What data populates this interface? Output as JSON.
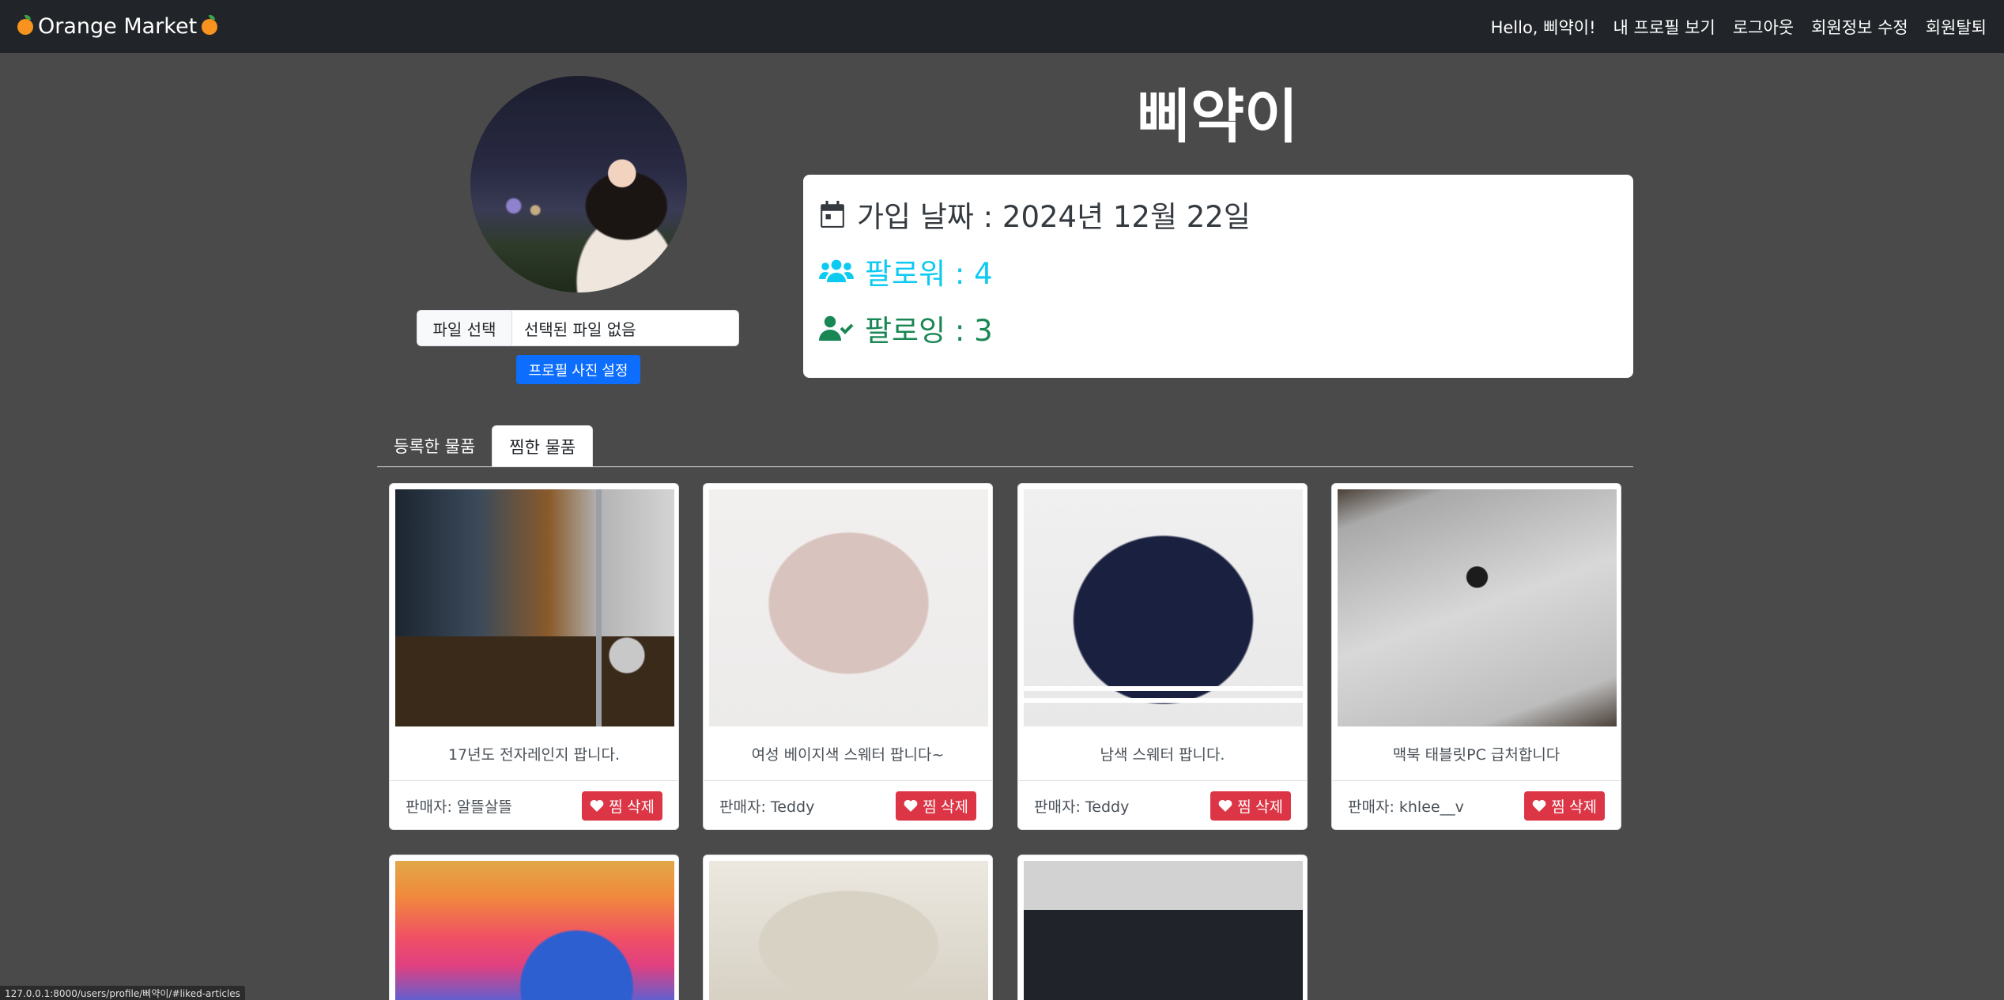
{
  "navbar": {
    "brand": "Orange Market",
    "links": [
      "Hello, 삐약이!",
      "내 프로필 보기",
      "로그아웃",
      "회원정보 수정",
      "회원탈퇴"
    ]
  },
  "profile": {
    "username": "삐약이",
    "file_button": "파일 선택",
    "file_status": "선택된 파일 없음",
    "set_photo_button": "프로필 사진 설정",
    "join_date": "가입 날짜 : 2024년 12월 22일",
    "followers": "팔로워 : 4",
    "following": "팔로잉 : 3"
  },
  "tabs": [
    "등록한 물품",
    "찜한 물품"
  ],
  "active_tab": "찜한 물품",
  "unlike_label": "찜 삭제",
  "products": [
    {
      "title": "17년도 전자레인지 팝니다.",
      "seller": "판매자: 알뜰살뜰",
      "image": "microwave"
    },
    {
      "title": "여성 베이지색 스웨터 팝니다~",
      "seller": "판매자: Teddy",
      "image": "beige-sweater"
    },
    {
      "title": "남색 스웨터 팝니다.",
      "seller": "판매자: Teddy",
      "image": "navy-sweater"
    },
    {
      "title": "맥북 태블릿PC 급처합니다",
      "seller": "판매자: khlee__v",
      "image": "ipad"
    },
    {
      "title": "",
      "seller": "",
      "image": "ipad-lockscreen"
    },
    {
      "title": "",
      "seller": "",
      "image": "pants"
    },
    {
      "title": "",
      "seller": "",
      "image": "bag"
    }
  ],
  "status_url": "127.0.0.1:8000/users/profile/삐약이/#liked-articles",
  "colors": {
    "navbar": "#212529",
    "background": "#4a4a4a",
    "primary": "#0d6efd",
    "danger": "#dc3545",
    "info": "#0dcaf0",
    "success": "#198754"
  }
}
